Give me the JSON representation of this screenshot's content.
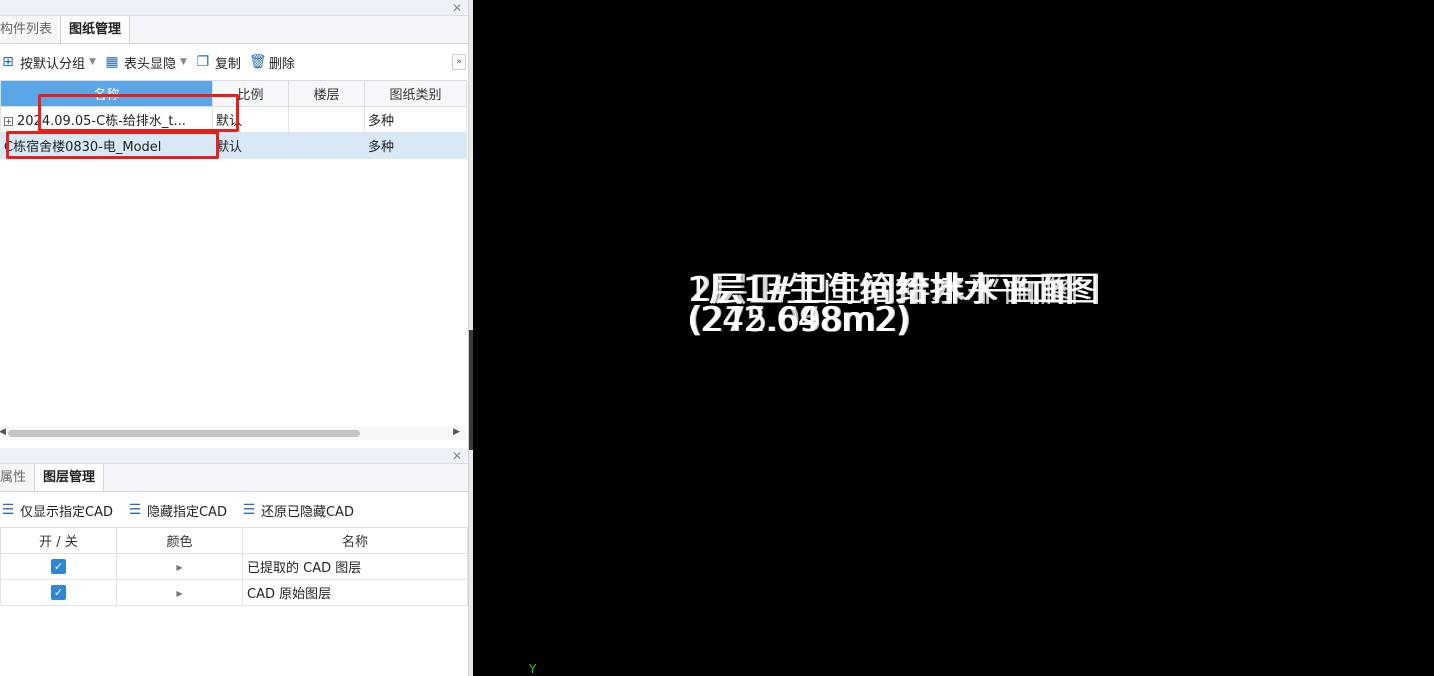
{
  "drawing_panel": {
    "tabs": [
      "构件列表",
      "图纸管理"
    ],
    "active_tab": 1,
    "toolbar": {
      "group_label": "按默认分组",
      "header_toggle_label": "表头显隐",
      "copy_label": "复制",
      "delete_label": "删除"
    },
    "columns": [
      "名称",
      "比例",
      "楼层",
      "图纸类别"
    ],
    "rows": [
      {
        "expander": "+",
        "name": "2024.09.05-C栋-给排水_t...",
        "scale": "默认",
        "floor": "",
        "category": "多种",
        "selected": false
      },
      {
        "expander": "",
        "name": "C栋宿舍楼0830-电_Model",
        "scale": "默认",
        "floor": "",
        "category": "多种",
        "selected": true
      }
    ]
  },
  "layer_panel": {
    "tabs": [
      "属性",
      "图层管理"
    ],
    "active_tab": 1,
    "toolbar": {
      "show_only_label": "仅显示指定CAD",
      "hide_label": "隐藏指定CAD",
      "restore_label": "还原已隐藏CAD"
    },
    "columns": [
      "开 / 关",
      "颜色",
      "名称"
    ],
    "rows": [
      {
        "on": true,
        "name": "已提取的 CAD 图层"
      },
      {
        "on": true,
        "name": "CAD 原始图层"
      }
    ]
  },
  "canvas": {
    "overlapping_titles": [
      "1层1#卫生间给排水平面图",
      "2层1#卫生间给排水平面图",
      "1层卫生间给排水平面图",
      "2层卫生间给排水平面图"
    ],
    "overlapping_areas": [
      "(242.648m2)",
      "(275.698m2)",
      "(242.098m2)",
      "(275.058m2)"
    ],
    "axis_label": "Y"
  }
}
